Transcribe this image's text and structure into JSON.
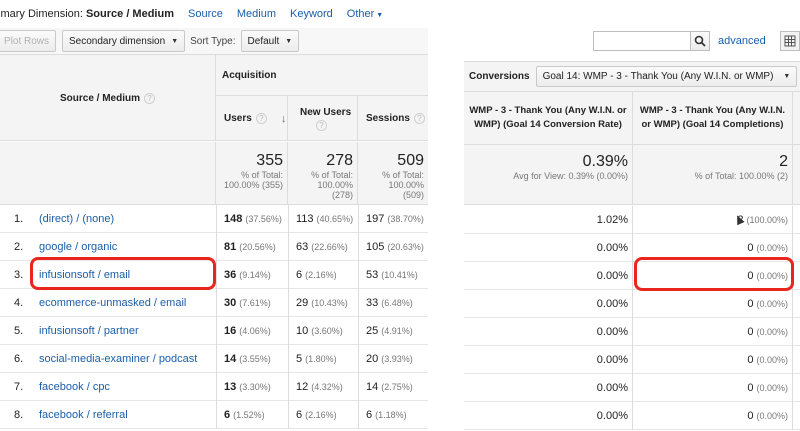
{
  "dimension_bar": {
    "prefix": "imary Dimension:",
    "selected": "Source / Medium",
    "options": [
      "Source",
      "Medium",
      "Keyword",
      "Other"
    ]
  },
  "toolbar": {
    "plot_rows": "Plot Rows",
    "secondary_dimension": "Secondary dimension",
    "sort_type_label": "Sort Type:",
    "sort_type_value": "Default"
  },
  "left_table": {
    "dimension_header": "Source / Medium",
    "group_header": "Acquisition",
    "columns": [
      "Users",
      "New Users",
      "Sessions"
    ],
    "totals": [
      {
        "value": "355",
        "line1": "% of Total:",
        "line2": "100.00% (355)",
        "line3": ""
      },
      {
        "value": "278",
        "line1": "% of Total:",
        "line2": "100.00%",
        "line3": "(278)"
      },
      {
        "value": "509",
        "line1": "% of Total:",
        "line2": "100.00%",
        "line3": "(509)"
      }
    ],
    "rows": [
      {
        "index": "1.",
        "source": "(direct) / (none)",
        "users": "148",
        "users_pct": "(37.56%)",
        "new_users": "113",
        "new_users_pct": "(40.65%)",
        "sessions": "197",
        "sessions_pct": "(38.70%)"
      },
      {
        "index": "2.",
        "source": "google / organic",
        "users": "81",
        "users_pct": "(20.56%)",
        "new_users": "63",
        "new_users_pct": "(22.66%)",
        "sessions": "105",
        "sessions_pct": "(20.63%)"
      },
      {
        "index": "3.",
        "source": "infusionsoft / email",
        "users": "36",
        "users_pct": "(9.14%)",
        "new_users": "6",
        "new_users_pct": "(2.16%)",
        "sessions": "53",
        "sessions_pct": "(10.41%)"
      },
      {
        "index": "4.",
        "source": "ecommerce-unmasked / email",
        "users": "30",
        "users_pct": "(7.61%)",
        "new_users": "29",
        "new_users_pct": "(10.43%)",
        "sessions": "33",
        "sessions_pct": "(6.48%)"
      },
      {
        "index": "5.",
        "source": "infusionsoft / partner",
        "users": "16",
        "users_pct": "(4.06%)",
        "new_users": "10",
        "new_users_pct": "(3.60%)",
        "sessions": "25",
        "sessions_pct": "(4.91%)"
      },
      {
        "index": "6.",
        "source": "social-media-examiner / podcast",
        "users": "14",
        "users_pct": "(3.55%)",
        "new_users": "5",
        "new_users_pct": "(1.80%)",
        "sessions": "20",
        "sessions_pct": "(3.93%)"
      },
      {
        "index": "7.",
        "source": "facebook / cpc",
        "users": "13",
        "users_pct": "(3.30%)",
        "new_users": "12",
        "new_users_pct": "(4.32%)",
        "sessions": "14",
        "sessions_pct": "(2.75%)"
      },
      {
        "index": "8.",
        "source": "facebook / referral",
        "users": "6",
        "users_pct": "(1.52%)",
        "new_users": "6",
        "new_users_pct": "(2.16%)",
        "sessions": "6",
        "sessions_pct": "(1.18%)"
      }
    ]
  },
  "right_panel": {
    "search_placeholder": "",
    "advanced_label": "advanced",
    "conversions_label": "Conversions",
    "goal_select": "Goal 14: WMP - 3 - Thank You (Any W.I.N. or WMP)",
    "col1_header": "WMP - 3 - Thank You (Any W.I.N. or WMP) (Goal 14 Conversion Rate)",
    "col2_header": "WMP - 3 - Thank You (Any W.I.N. or WMP) (Goal 14 Completions)",
    "totals": {
      "rate": "0.39%",
      "rate_sub": "Avg for View: 0.39% (0.00%)",
      "completions": "2",
      "completions_sub": "% of Total: 100.00% (2)"
    },
    "rows": [
      {
        "rate": "1.02%",
        "completions": "2",
        "completions_pct": "(100.00%)"
      },
      {
        "rate": "0.00%",
        "completions": "0",
        "completions_pct": "(0.00%)"
      },
      {
        "rate": "0.00%",
        "completions": "0",
        "completions_pct": "(0.00%)"
      },
      {
        "rate": "0.00%",
        "completions": "0",
        "completions_pct": "(0.00%)"
      },
      {
        "rate": "0.00%",
        "completions": "0",
        "completions_pct": "(0.00%)"
      },
      {
        "rate": "0.00%",
        "completions": "0",
        "completions_pct": "(0.00%)"
      },
      {
        "rate": "0.00%",
        "completions": "0",
        "completions_pct": "(0.00%)"
      },
      {
        "rate": "0.00%",
        "completions": "0",
        "completions_pct": "(0.00%)"
      }
    ]
  },
  "colors": {
    "link": "#1a5ea8",
    "highlight": "#e8261d"
  }
}
